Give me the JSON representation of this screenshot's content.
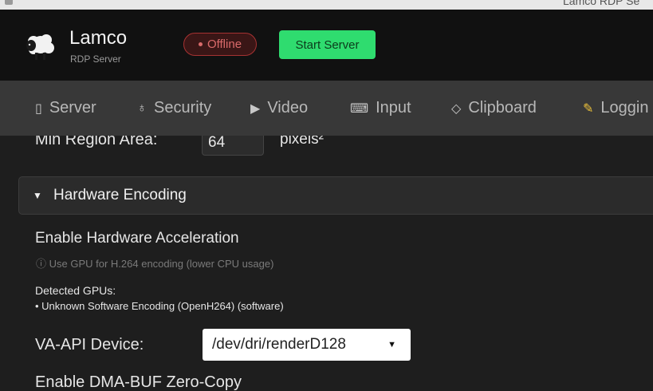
{
  "window": {
    "title": "Lamco RDP Se"
  },
  "header": {
    "app_name": "Lamco",
    "app_subtitle": "RDP Server",
    "status": "Offline",
    "start_label": "Start Server",
    "logo_icon": "sheep-icon"
  },
  "tabs": [
    {
      "label": "Server",
      "icon": "server-icon"
    },
    {
      "label": "Security",
      "icon": "lock-icon"
    },
    {
      "label": "Video",
      "icon": "video-icon"
    },
    {
      "label": "Input",
      "icon": "keyboard-icon"
    },
    {
      "label": "Clipboard",
      "icon": "clipboard-icon"
    },
    {
      "label": "Loggin",
      "icon": "memo-icon"
    }
  ],
  "video": {
    "min_region_label": "Min Region Area:",
    "min_region_value": "64",
    "min_region_unit": "pixels²",
    "hw_section": {
      "title": "Hardware Encoding",
      "expanded": true
    },
    "hw_accel_label": "Enable Hardware Acceleration",
    "hw_accel_hint": "ⓘ Use GPU for H.264 encoding (lower CPU usage)",
    "gpus_label": "Detected GPUs:",
    "gpus": [
      "• Unknown Software Encoding (OpenH264) (software)"
    ],
    "vaapi_label": "VA-API Device:",
    "vaapi_value": "/dev/dri/renderD128",
    "dma_label": "Enable DMA-BUF Zero-Copy"
  },
  "colors": {
    "accent_green": "#2fdc6f",
    "offline_red": "#d96a6a",
    "header_bg": "#111111",
    "tabbar_bg": "#383838",
    "content_bg": "#1e1e1e"
  }
}
